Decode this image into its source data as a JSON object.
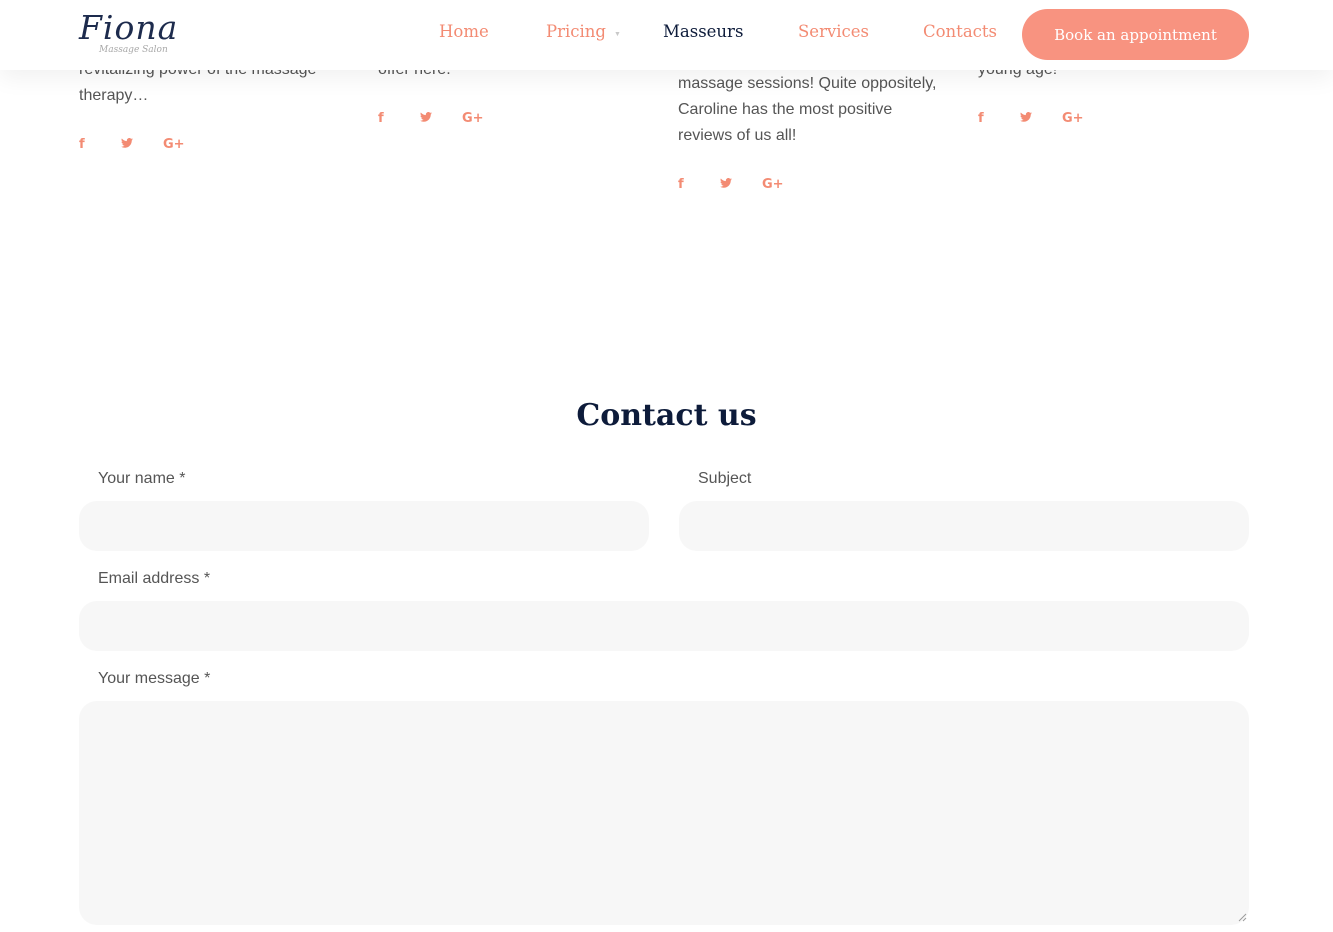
{
  "header": {
    "logo": {
      "script": "Fiona",
      "subtitle": "Massage Salon"
    },
    "nav": [
      {
        "label": "Home",
        "active": false
      },
      {
        "label": "Pricing",
        "active": false,
        "has_dropdown": true
      },
      {
        "label": "Masseurs",
        "active": true
      },
      {
        "label": "Services",
        "active": false
      },
      {
        "label": "Contacts",
        "active": false
      }
    ],
    "book_button": "Book an appointment"
  },
  "masseurs": [
    {
      "bio_lines": [
        "revitalizing power of the massage",
        "therapy…"
      ]
    },
    {
      "bio_lines": [
        "offer here."
      ]
    },
    {
      "bio_lines": [
        "massage sessions! Quite oppositely,",
        "Caroline has the most positive",
        "reviews of us all!"
      ]
    },
    {
      "bio_lines": [
        "young age!"
      ]
    }
  ],
  "social_icons": [
    "facebook-icon",
    "twitter-icon",
    "google-plus-icon"
  ],
  "contact": {
    "title": "Contact us",
    "name_label": "Your name *",
    "subject_label": "Subject",
    "email_label": "Email address *",
    "message_label": "Your message *",
    "name_value": "",
    "subject_value": "",
    "email_value": "",
    "message_value": ""
  },
  "colors": {
    "accent": "#f38b73",
    "button": "#f89380",
    "dark": "#0d1b3a",
    "field_bg": "#f7f7f7"
  }
}
